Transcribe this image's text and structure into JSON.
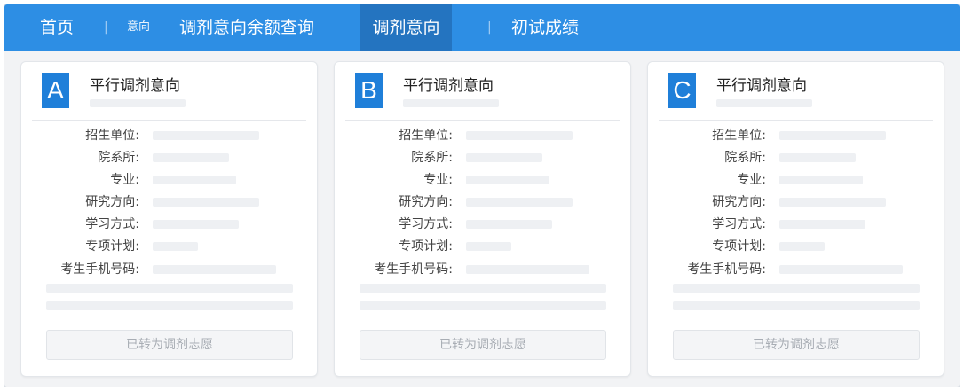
{
  "nav": {
    "home": "首页",
    "sep1": "|",
    "intent_small": "意向",
    "query": "调剂意向余额查询",
    "active_tab": "调剂意向",
    "sep2": "|",
    "score": "初试成绩"
  },
  "cards": [
    {
      "letter": "A",
      "title": "平行调剂意向",
      "button": "已转为调剂志愿"
    },
    {
      "letter": "B",
      "title": "平行调剂意向",
      "button": "已转为调剂志愿"
    },
    {
      "letter": "C",
      "title": "平行调剂意向",
      "button": "已转为调剂志愿"
    }
  ],
  "fields": {
    "unit": "招生单位:",
    "department": "院系所:",
    "major": "专业:",
    "direction": "研究方向:",
    "study_mode": "学习方式:",
    "special_plan": "专项计划:",
    "phone": "考生手机号码:"
  },
  "colors": {
    "nav_bg": "#2d8ee4",
    "nav_active_bg": "#2474c0",
    "badge_bg": "#1f7fd9"
  }
}
